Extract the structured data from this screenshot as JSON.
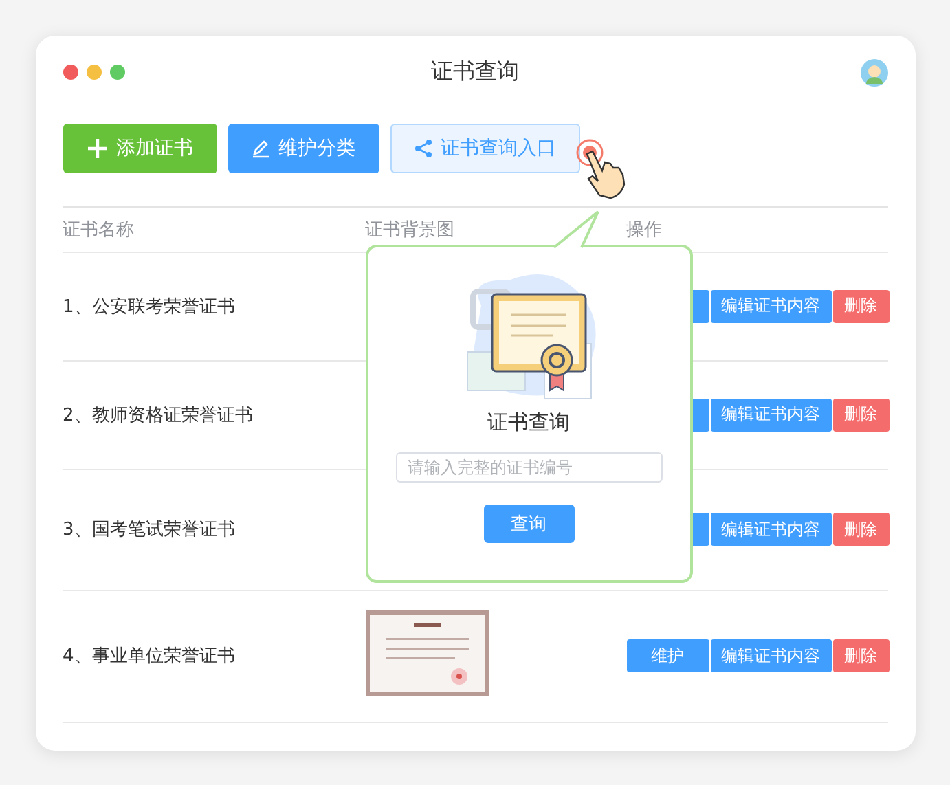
{
  "window": {
    "title": "证书查询"
  },
  "toolbar": [
    {
      "label": "添加证书",
      "kind": "add"
    },
    {
      "label": "维护分类",
      "kind": "edit"
    },
    {
      "label": "证书查询入口",
      "kind": "share"
    }
  ],
  "table": {
    "columns": [
      "证书名称",
      "证书背景图",
      "操作"
    ],
    "rows": [
      {
        "name": "1、公安联考荣誉证书",
        "actions": [
          {
            "kind": "primary"
          },
          {
            "kind": "primary",
            "label": "编辑证书内容"
          },
          {
            "kind": "danger",
            "label": "删除"
          }
        ]
      },
      {
        "name": "2、教师资格证荣誉证书",
        "actions": [
          {
            "kind": "primary"
          },
          {
            "kind": "primary",
            "label": "编辑证书内容"
          },
          {
            "kind": "danger",
            "label": "删除"
          }
        ]
      },
      {
        "name": "3、国考笔试荣誉证书",
        "actions": [
          {
            "kind": "primary"
          },
          {
            "kind": "primary",
            "label": "编辑证书内容"
          },
          {
            "kind": "danger",
            "label": "删除"
          }
        ]
      },
      {
        "name": "4、事业单位荣誉证书",
        "image": {
          "kind": "picture"
        },
        "actions": [
          {
            "kind": "primary",
            "label": "维护"
          },
          {
            "kind": "primary",
            "label": "编辑证书内容"
          },
          {
            "kind": "danger",
            "label": "删除"
          }
        ]
      }
    ]
  },
  "popup": {
    "title": "证书查询",
    "input": {
      "placeholder": "请输入完整的证书编号"
    },
    "button": "查询"
  }
}
